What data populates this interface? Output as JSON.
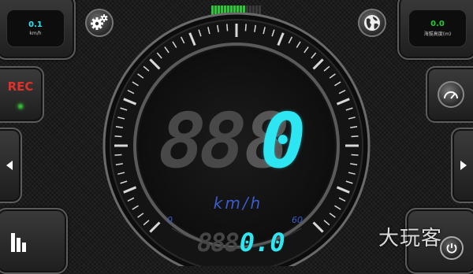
{
  "left_readout": {
    "value": "0.1",
    "unit": "km/h"
  },
  "right_readout": {
    "value": "0.0",
    "unit": "海拔高度(m)"
  },
  "rec_label": "REC",
  "speed": {
    "ghost_digits": "88",
    "ghost_active": "8",
    "value": "0",
    "unit": "km/h",
    "scale_min": "0",
    "scale_max": "60"
  },
  "odometer": {
    "ghost": "888",
    "value": "0.0"
  },
  "watermark": "大玩客",
  "colors": {
    "accent": "#2ee6f2",
    "ghost": "#4a4a4a",
    "rec": "#e0302a",
    "unit_blue": "#3a5ccc",
    "signal": "#22cc33"
  },
  "icons": {
    "settings": "gear-icon",
    "globe": "globe-icon",
    "gauge": "speedometer-icon",
    "left": "arrow-left-icon",
    "right": "arrow-right-icon",
    "bars": "bar-chart-icon",
    "power": "power-icon",
    "signal": "signal-strength-icon",
    "led": "recording-led-icon"
  }
}
